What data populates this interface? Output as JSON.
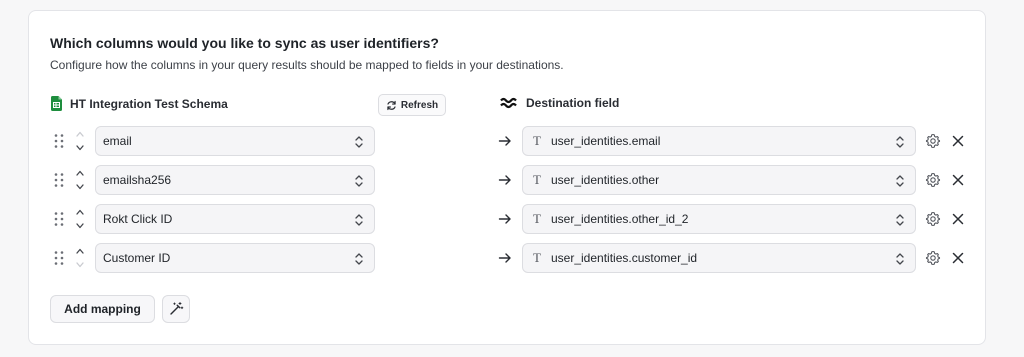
{
  "section": {
    "title": "Which columns would you like to sync as user identifiers?",
    "subtitle": "Configure how the columns in your query results should be mapped to fields in your destinations."
  },
  "source": {
    "icon": "google-sheets-icon",
    "label": "HT Integration Test Schema",
    "refresh_label": "Refresh"
  },
  "destination": {
    "icon": "destination-logo-icon",
    "label": "Destination field"
  },
  "mappings": [
    {
      "source": "email",
      "destination": "user_identities.email"
    },
    {
      "source": "emailsha256",
      "destination": "user_identities.other"
    },
    {
      "source": "Rokt Click ID",
      "destination": "user_identities.other_id_2"
    },
    {
      "source": "Customer ID",
      "destination": "user_identities.customer_id"
    }
  ],
  "actions": {
    "add_mapping_label": "Add mapping",
    "magic_icon": "magic-wand-icon"
  },
  "colors": {
    "border": "#dcdde1",
    "field_bg": "#f5f5f7",
    "sheets_green": "#1e8e3e"
  }
}
